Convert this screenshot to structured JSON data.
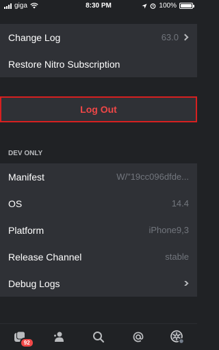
{
  "status_bar": {
    "carrier": "giga",
    "time": "8:30 PM",
    "battery": "100%"
  },
  "settings": {
    "change_log": {
      "label": "Change Log",
      "value": "63.0"
    },
    "restore": {
      "label": "Restore Nitro Subscription"
    },
    "logout": {
      "label": "Log Out"
    }
  },
  "dev_only": {
    "header": "DEV ONLY",
    "rows": [
      {
        "label": "Manifest",
        "value": "W/\"19cc096dfde..."
      },
      {
        "label": "OS",
        "value": "14.4"
      },
      {
        "label": "Platform",
        "value": "iPhone9,3"
      },
      {
        "label": "Release Channel",
        "value": "stable"
      },
      {
        "label": "Debug Logs",
        "value": ""
      }
    ]
  },
  "tab_bar": {
    "home_badge": "92",
    "tabs": [
      {
        "icon": "home-icon"
      },
      {
        "icon": "friends-icon"
      },
      {
        "icon": "search-icon"
      },
      {
        "icon": "mentions-icon"
      },
      {
        "icon": "profile-icon"
      }
    ]
  },
  "colors": {
    "background": "#202225",
    "row_background": "#2f3136",
    "logout_text": "#f04747",
    "logout_border": "#d72020",
    "badge": "#f04747"
  }
}
